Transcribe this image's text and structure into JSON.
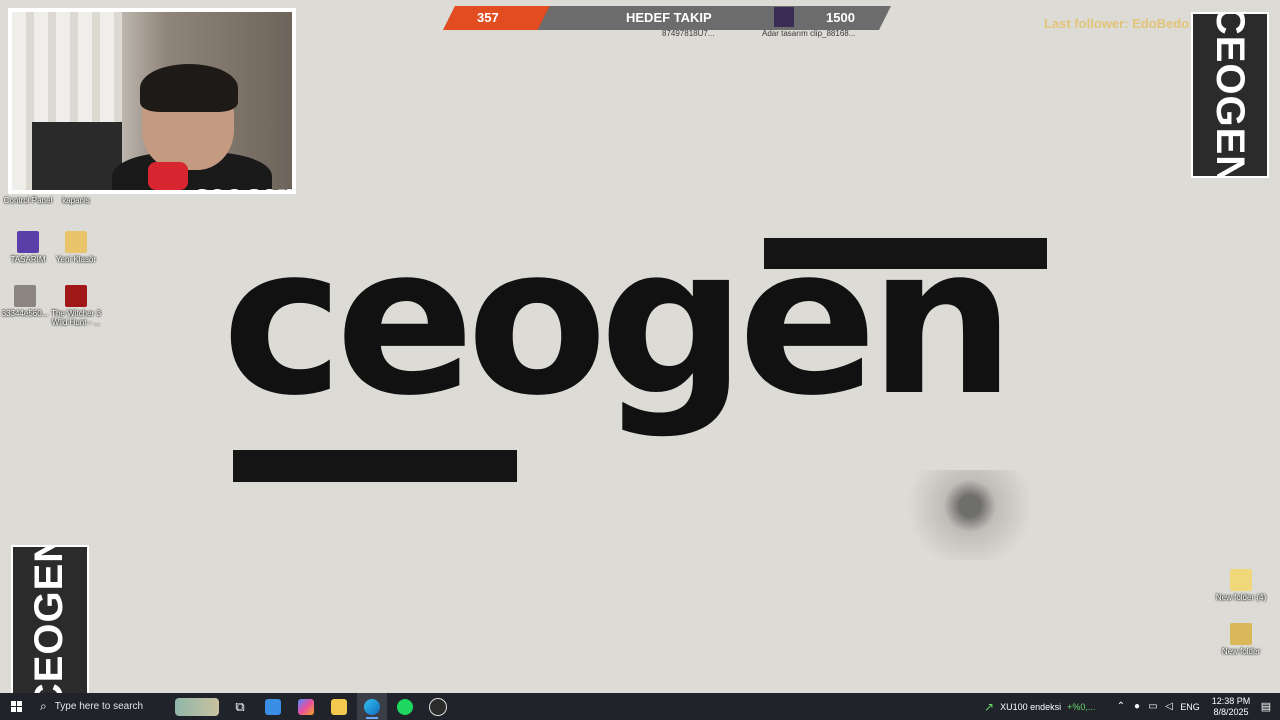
{
  "overlay": {
    "webcam_name": "ceogen",
    "goal": {
      "current": "357",
      "title": "HEDEF TAKIP",
      "target": "1500",
      "progress": 0.238,
      "sub_left": "87497818U7...",
      "sub_right": "Adar tasarım clip_88168...",
      "fill_color": "#e14d21"
    },
    "last_follower": "Last follower: EdoBedo",
    "badge_top": "CEOGEN",
    "badge_bottom": "CEOGEN"
  },
  "desktop_icons": [
    {
      "label": "Control Panel",
      "icon": "control-panel-icon"
    },
    {
      "label": "kapanis",
      "icon": "shortcut-icon"
    },
    {
      "label": "TASARIM",
      "icon": "design-file-icon"
    },
    {
      "label": "Yeni Klasör",
      "icon": "folder-icon"
    },
    {
      "label": "33344e560...",
      "icon": "image-file-icon"
    },
    {
      "label": "The Witcher 3 Wild Hunt - ...",
      "icon": "game-icon"
    },
    {
      "label": "New folder (4)",
      "icon": "folder-icon"
    },
    {
      "label": "New folder",
      "icon": "folder-icon"
    }
  ],
  "wallpaper": {
    "wordmark": "ceogen"
  },
  "taskbar": {
    "search_placeholder": "Type here to search",
    "stock": "XU100 endeksi",
    "stock_change": "+%0,...",
    "language": "ENG",
    "time": "12:38 PM",
    "date": "8/8/2025"
  },
  "colors": {
    "wallpaper": "#dddbd5",
    "taskbar": "#20232a",
    "accent": "#e14d21",
    "badge": "#2b2b2b"
  }
}
